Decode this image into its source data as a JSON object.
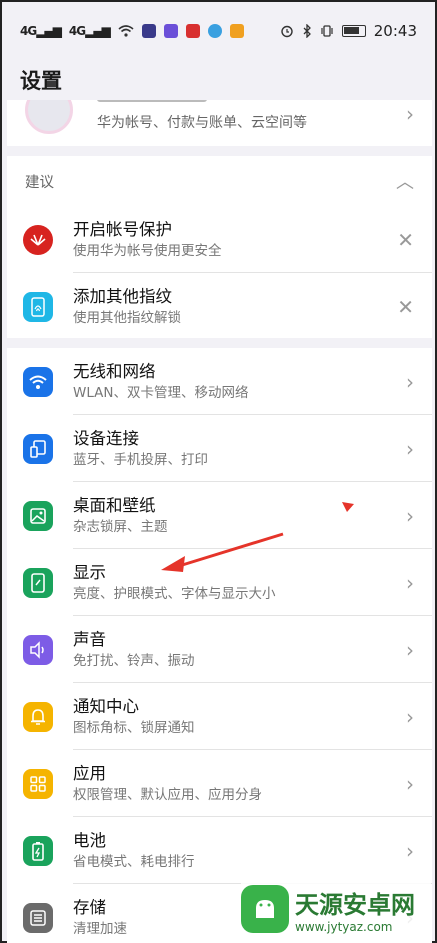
{
  "statusbar": {
    "sig1": "4G",
    "sig2": "4G",
    "time": "20:43",
    "icons": [
      "signal-icon",
      "signal-icon",
      "wifi-icon",
      "app-icon",
      "app-icon",
      "app-icon",
      "app-icon",
      "app-icon",
      "alarm-icon",
      "bluetooth-icon",
      "vibrate-icon",
      "battery-icon"
    ]
  },
  "title": "设置",
  "account": {
    "subtitle": "华为帐号、付款与账单、云空间等"
  },
  "suggestion": {
    "header": "建议",
    "items": [
      {
        "title": "开启帐号保护",
        "subtitle": "使用华为帐号使用更安全",
        "icon": "huawei-icon"
      },
      {
        "title": "添加其他指纹",
        "subtitle": "使用其他指纹解锁",
        "icon": "fingerprint-icon"
      }
    ]
  },
  "settings": {
    "items": [
      {
        "title": "无线和网络",
        "subtitle": "WLAN、双卡管理、移动网络",
        "icon": "wifi-icon",
        "color": "#1a73e8"
      },
      {
        "title": "设备连接",
        "subtitle": "蓝牙、手机投屏、打印",
        "icon": "device-icon",
        "color": "#1a73e8"
      },
      {
        "title": "桌面和壁纸",
        "subtitle": "杂志锁屏、主题",
        "icon": "wallpaper-icon",
        "color": "#1aa35c"
      },
      {
        "title": "显示",
        "subtitle": "亮度、护眼模式、字体与显示大小",
        "icon": "display-icon",
        "color": "#1aa35c"
      },
      {
        "title": "声音",
        "subtitle": "免打扰、铃声、振动",
        "icon": "sound-icon",
        "color": "#7d5ce6"
      },
      {
        "title": "通知中心",
        "subtitle": "图标角标、锁屏通知",
        "icon": "bell-icon",
        "color": "#f5b400"
      },
      {
        "title": "应用",
        "subtitle": "权限管理、默认应用、应用分身",
        "icon": "apps-icon",
        "color": "#f5b400"
      },
      {
        "title": "电池",
        "subtitle": "省电模式、耗电排行",
        "icon": "battery-icon",
        "color": "#1aa35c"
      },
      {
        "title": "存储",
        "subtitle": "清理加速",
        "icon": "storage-icon",
        "color": "#6b6b6b"
      }
    ]
  },
  "watermark": {
    "name": "天源安卓网",
    "url": "www.jytyaz.com"
  }
}
